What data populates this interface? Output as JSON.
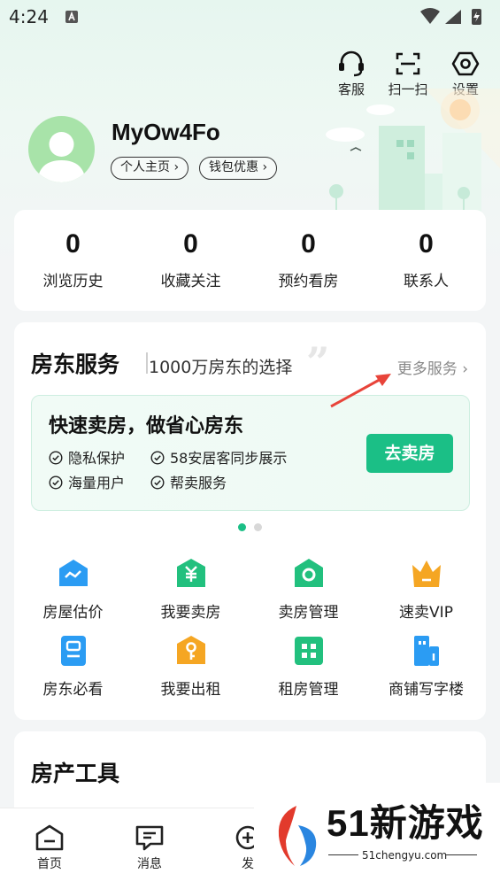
{
  "status_bar": {
    "time": "4:24"
  },
  "top_actions": [
    {
      "label": "客服",
      "icon": "headset-icon"
    },
    {
      "label": "扫一扫",
      "icon": "scan-icon"
    },
    {
      "label": "设置",
      "icon": "settings-icon"
    }
  ],
  "profile": {
    "username": "MyOw4Fo",
    "links": [
      "个人主页 ›",
      "钱包优惠 ›"
    ]
  },
  "stats": [
    {
      "value": "0",
      "label": "浏览历史"
    },
    {
      "value": "0",
      "label": "收藏关注"
    },
    {
      "value": "0",
      "label": "预约看房"
    },
    {
      "value": "0",
      "label": "联系人"
    }
  ],
  "landlord_services": {
    "title": "房东服务",
    "subtitle": "1000万房东的选择",
    "more": "更多服务 ›",
    "banner": {
      "title": "快速卖房，做省心房东",
      "features": [
        "隐私保护",
        "58安居客同步展示",
        "海量用户",
        "帮卖服务"
      ],
      "button": "去卖房"
    },
    "carousel": {
      "count": 2,
      "active": 0
    },
    "items": [
      {
        "label": "房屋估价",
        "icon": "house-valuation-icon",
        "color": "#2b9cf3"
      },
      {
        "label": "我要卖房",
        "icon": "sell-house-icon",
        "color": "#22c07e"
      },
      {
        "label": "卖房管理",
        "icon": "sell-management-icon",
        "color": "#22c07e"
      },
      {
        "label": "速卖VIP",
        "icon": "vip-crown-icon",
        "color": "#f5a623"
      },
      {
        "label": "房东必看",
        "icon": "landlord-guide-icon",
        "color": "#2b9cf3"
      },
      {
        "label": "我要出租",
        "icon": "rent-out-key-icon",
        "color": "#f5a623"
      },
      {
        "label": "租房管理",
        "icon": "rent-management-icon",
        "color": "#22c07e"
      },
      {
        "label": "商铺写字楼",
        "icon": "office-building-icon",
        "color": "#2b9cf3"
      }
    ]
  },
  "property_tools": {
    "title": "房产工具"
  },
  "bottom_nav": [
    {
      "label": "首页",
      "icon": "home-icon"
    },
    {
      "label": "消息",
      "icon": "message-icon"
    },
    {
      "label": "发",
      "icon": "post-icon"
    }
  ],
  "watermark": {
    "text": "51新游戏",
    "url": "51chengyu.com"
  },
  "colors": {
    "accent": "#1bbf86",
    "arrow": "#e8443a"
  }
}
